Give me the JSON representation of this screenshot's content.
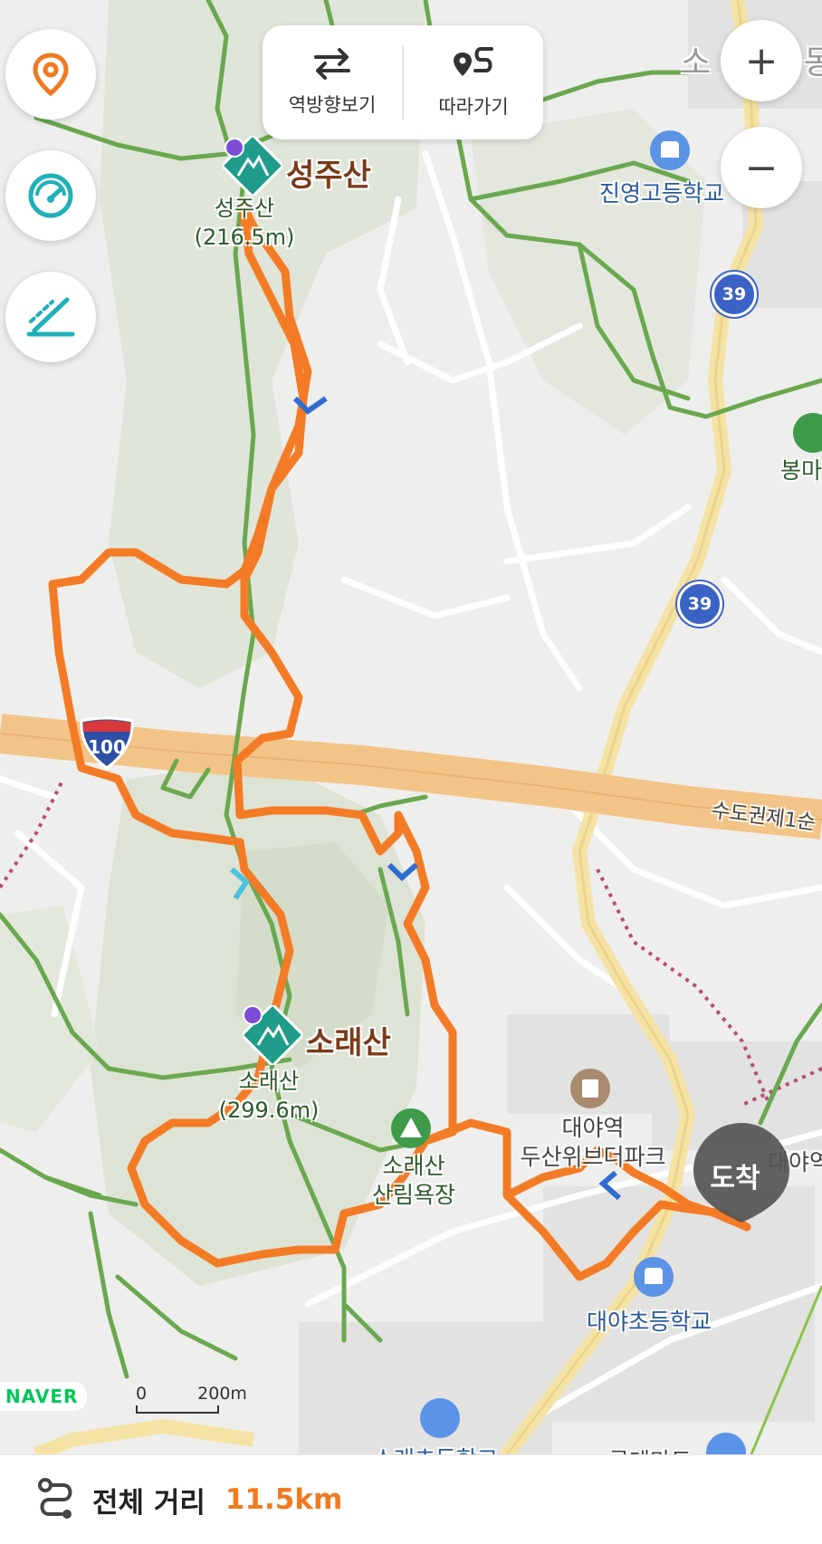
{
  "toolbar": {
    "reverse_label": "역방향보기",
    "follow_label": "따라가기"
  },
  "side_buttons": {
    "location_icon": "location-pin-icon",
    "speed_icon": "speedometer-icon",
    "elevation_icon": "elevation-slope-icon"
  },
  "zoom": {
    "in_label": "+",
    "out_label": "−"
  },
  "map": {
    "peaks": [
      {
        "name": "성주산",
        "sub_line1": "성주산",
        "sub_line2": "(216.5m)"
      },
      {
        "name": "소래산",
        "sub_line1": "소래산",
        "sub_line2": "(299.6m)"
      }
    ],
    "pois": {
      "jinyoung_school": "진영고등학교",
      "daeya_station_park_1": "대야역",
      "daeya_station_park_2": "두산위브더파크",
      "daeya_elementary": "대야초등학교",
      "sorae_forest_1": "소래산",
      "sorae_forest_2": "산림욕장",
      "bongma": "봉마",
      "daeya_station_edge": "대야역",
      "top_right_partial": "소",
      "top_right_partial2": "동",
      "bottom_school_partial": "소래초등학교",
      "bottom_mart_partial": "롯데마트"
    },
    "highway_name": "수도권제1순",
    "highway_shield": "100",
    "route_badges": [
      "39",
      "39"
    ],
    "arrive_label": "도착",
    "naver_logo": "NAVER",
    "scale_zero": "0",
    "scale_dist": "200m",
    "route_color": "#f47b25",
    "trail_color": "#6aa84f"
  },
  "summary": {
    "icon": "route-icon",
    "label": "전체 거리",
    "value": "11.5km"
  }
}
